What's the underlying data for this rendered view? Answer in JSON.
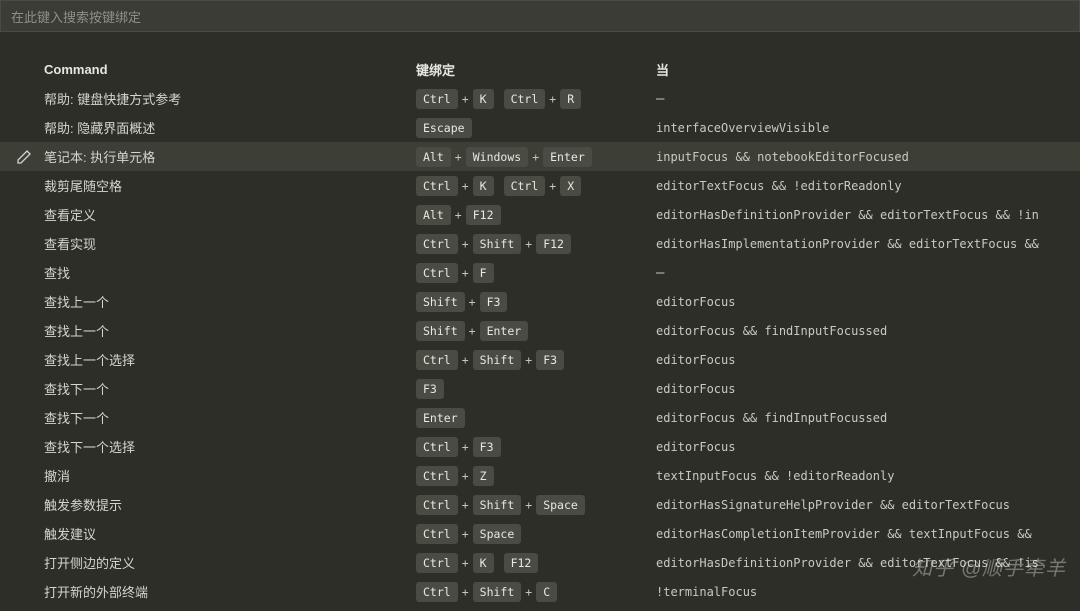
{
  "search": {
    "placeholder": "在此键入搜索按键绑定"
  },
  "headers": {
    "command": "Command",
    "binding": "键绑定",
    "when": "当"
  },
  "rows": [
    {
      "command": "帮助: 键盘快捷方式参考",
      "binding": [
        [
          "Ctrl",
          "K"
        ],
        [
          "Ctrl",
          "R"
        ]
      ],
      "when": "—",
      "highlight": false
    },
    {
      "command": "帮助: 隐藏界面概述",
      "binding": [
        [
          "Escape"
        ]
      ],
      "when": "interfaceOverviewVisible",
      "highlight": false
    },
    {
      "command": "笔记本: 执行单元格",
      "binding": [
        [
          "Alt",
          "Windows",
          "Enter"
        ]
      ],
      "when": "inputFocus && notebookEditorFocused",
      "highlight": true
    },
    {
      "command": "裁剪尾随空格",
      "binding": [
        [
          "Ctrl",
          "K"
        ],
        [
          "Ctrl",
          "X"
        ]
      ],
      "when": "editorTextFocus && !editorReadonly",
      "highlight": false
    },
    {
      "command": "查看定义",
      "binding": [
        [
          "Alt",
          "F12"
        ]
      ],
      "when": "editorHasDefinitionProvider && editorTextFocus && !in",
      "highlight": false
    },
    {
      "command": "查看实现",
      "binding": [
        [
          "Ctrl",
          "Shift",
          "F12"
        ]
      ],
      "when": "editorHasImplementationProvider && editorTextFocus &&",
      "highlight": false
    },
    {
      "command": "查找",
      "binding": [
        [
          "Ctrl",
          "F"
        ]
      ],
      "when": "—",
      "highlight": false
    },
    {
      "command": "查找上一个",
      "binding": [
        [
          "Shift",
          "F3"
        ]
      ],
      "when": "editorFocus",
      "highlight": false
    },
    {
      "command": "查找上一个",
      "binding": [
        [
          "Shift",
          "Enter"
        ]
      ],
      "when": "editorFocus && findInputFocussed",
      "highlight": false
    },
    {
      "command": "查找上一个选择",
      "binding": [
        [
          "Ctrl",
          "Shift",
          "F3"
        ]
      ],
      "when": "editorFocus",
      "highlight": false
    },
    {
      "command": "查找下一个",
      "binding": [
        [
          "F3"
        ]
      ],
      "when": "editorFocus",
      "highlight": false
    },
    {
      "command": "查找下一个",
      "binding": [
        [
          "Enter"
        ]
      ],
      "when": "editorFocus && findInputFocussed",
      "highlight": false
    },
    {
      "command": "查找下一个选择",
      "binding": [
        [
          "Ctrl",
          "F3"
        ]
      ],
      "when": "editorFocus",
      "highlight": false
    },
    {
      "command": "撤消",
      "binding": [
        [
          "Ctrl",
          "Z"
        ]
      ],
      "when": "textInputFocus && !editorReadonly",
      "highlight": false
    },
    {
      "command": "触发参数提示",
      "binding": [
        [
          "Ctrl",
          "Shift",
          "Space"
        ]
      ],
      "when": "editorHasSignatureHelpProvider && editorTextFocus",
      "highlight": false
    },
    {
      "command": "触发建议",
      "binding": [
        [
          "Ctrl",
          "Space"
        ]
      ],
      "when": "editorHasCompletionItemProvider && textInputFocus &&",
      "highlight": false
    },
    {
      "command": "打开侧边的定义",
      "binding": [
        [
          "Ctrl",
          "K"
        ],
        [
          "F12"
        ]
      ],
      "when": "editorHasDefinitionProvider && editorTextFocus && !is",
      "highlight": false
    },
    {
      "command": "打开新的外部终端",
      "binding": [
        [
          "Ctrl",
          "Shift",
          "C"
        ]
      ],
      "when": "!terminalFocus",
      "highlight": false
    }
  ],
  "watermark": "知乎 @顺手牵羊"
}
